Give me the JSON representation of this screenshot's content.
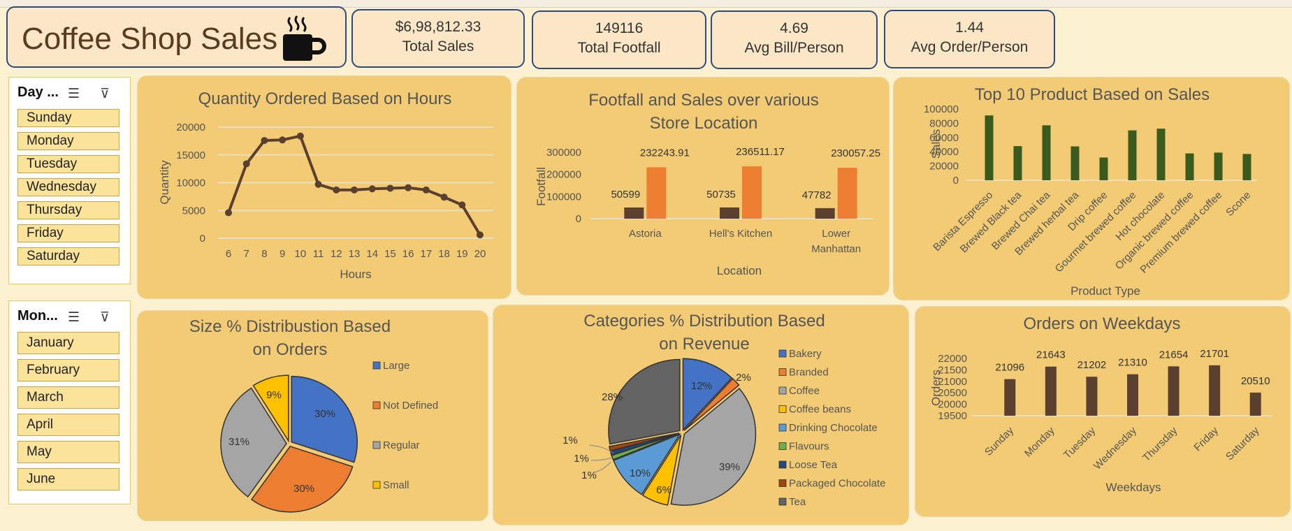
{
  "dashboard": {
    "title": "Coffee Shop Sales"
  },
  "kpis": [
    {
      "value": "$6,98,812.33",
      "label": "Total Sales"
    },
    {
      "value": "149116",
      "label": "Total Footfall"
    },
    {
      "value": "4.69",
      "label": "Avg Bill/Person"
    },
    {
      "value": "1.44",
      "label": "Avg Order/Person"
    }
  ],
  "slicers": {
    "day": {
      "header": "Day ...",
      "items": [
        "Sunday",
        "Monday",
        "Tuesday",
        "Wednesday",
        "Thursday",
        "Friday",
        "Saturday"
      ]
    },
    "month": {
      "header": "Mon...",
      "items": [
        "January",
        "February",
        "March",
        "April",
        "May",
        "June"
      ]
    }
  },
  "colors": {
    "panel": "#f2cb74",
    "dark_brown": "#5b4030",
    "orange": "#ed7d31",
    "green": "#3a5a1e",
    "blue": "#4472c4",
    "gray": "#a5a5a5",
    "gold": "#ffc000"
  },
  "chart_data": [
    {
      "type": "line",
      "title": "Quantity Ordered Based on Hours",
      "xlabel": "Hours",
      "ylabel": "Quantity",
      "x": [
        6,
        7,
        8,
        9,
        10,
        11,
        12,
        13,
        14,
        15,
        16,
        17,
        18,
        19,
        20
      ],
      "values": [
        4600,
        13400,
        17600,
        17700,
        18400,
        9700,
        8700,
        8700,
        8900,
        9000,
        9100,
        8700,
        7400,
        6000,
        600
      ],
      "ylim": [
        0,
        20000
      ],
      "yticks": [
        "0",
        "5000",
        "10000",
        "15000",
        "20000"
      ],
      "grid": true
    },
    {
      "type": "bar",
      "title": "Footfall and Sales over various Store Location",
      "xlabel": "Location",
      "ylabel": "Footfall",
      "categories": [
        "Astoria",
        "Hell's Kitchen",
        "Lower Manhattan"
      ],
      "series": [
        {
          "values": [
            50599,
            50735,
            47782
          ],
          "color": "#5b4030"
        },
        {
          "values": [
            232243.91,
            236511.17,
            230057.25
          ],
          "color": "#ed7d31"
        }
      ],
      "data_labels": [
        [
          "50599",
          "232243.91"
        ],
        [
          "50735",
          "236511.17"
        ],
        [
          "47782",
          "230057.25"
        ]
      ],
      "ylim": [
        0,
        300000
      ],
      "yticks": [
        "0",
        "100000",
        "200000",
        "300000"
      ]
    },
    {
      "type": "bar",
      "title": "Top 10 Product Based on Sales",
      "xlabel": "Product Type",
      "ylabel": "Sales",
      "categories": [
        "Barista Espresso",
        "Brewed Black tea",
        "Brewed Chai tea",
        "Brewed herbal tea",
        "Drip coffee",
        "Gourmet brewed coffee",
        "Hot chocolate",
        "Organic brewed coffee",
        "Premium brewed coffee",
        "Scone"
      ],
      "values": [
        91000,
        47900,
        77100,
        47500,
        31900,
        70000,
        72400,
        37700,
        38800,
        36900
      ],
      "ylim": [
        0,
        100000
      ],
      "yticks": [
        "0",
        "20000",
        "40000",
        "60000",
        "80000",
        "100000"
      ]
    },
    {
      "type": "pie",
      "title": "Size % Distribustion Based on Orders",
      "labels": [
        "Large",
        "Not Defined",
        "Regular",
        "Small"
      ],
      "values": [
        30,
        30,
        31,
        9
      ],
      "value_labels": [
        "30%",
        "30%",
        "31%",
        "9%"
      ],
      "colors": [
        "#4472c4",
        "#ed7d31",
        "#a5a5a5",
        "#ffc000"
      ],
      "legend": "right"
    },
    {
      "type": "pie",
      "title": "Categories % Distribution Based on Revenue",
      "labels": [
        "Bakery",
        "Branded",
        "Coffee",
        "Coffee beans",
        "Drinking Chocolate",
        "Flavours",
        "Loose Tea",
        "Packaged Chocolate",
        "Tea"
      ],
      "values": [
        12,
        2,
        39,
        6,
        10,
        1,
        1,
        1,
        28
      ],
      "value_labels": [
        "12%",
        "2%",
        "39%",
        "6%",
        "10%",
        "1%",
        "1%",
        "1%",
        "28%"
      ],
      "colors": [
        "#4472c4",
        "#ed7d31",
        "#a5a5a5",
        "#ffc000",
        "#5b9bd5",
        "#70ad47",
        "#264478",
        "#9e480e",
        "#636363"
      ],
      "legend": "right"
    },
    {
      "type": "bar",
      "title": "Orders on Weekdays",
      "xlabel": "Weekdays",
      "ylabel": "Orders",
      "categories": [
        "Sunday",
        "Monday",
        "Tuesday",
        "Wednesday",
        "Thursday",
        "Friday",
        "Saturday"
      ],
      "values": [
        21096,
        21643,
        21202,
        21310,
        21654,
        21701,
        20510
      ],
      "ylim": [
        19500,
        22000
      ],
      "yticks": [
        "19500",
        "20000",
        "20500",
        "21000",
        "21500",
        "22000"
      ]
    }
  ]
}
